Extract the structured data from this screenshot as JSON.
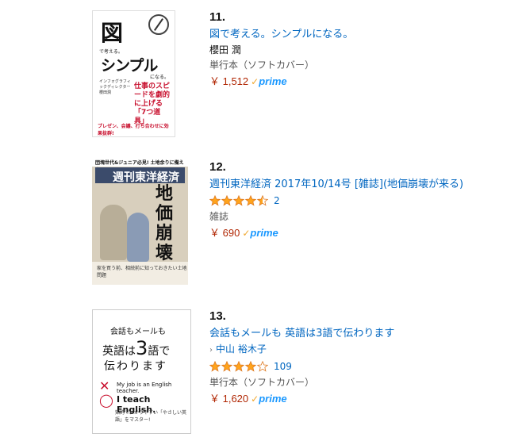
{
  "items": [
    {
      "rank": "11.",
      "title": "図で考える。シンプルになる。",
      "author": "櫻田 潤",
      "format": "単行本（ソフトカバー）",
      "price": "￥ 1,512",
      "prime_check": "✓",
      "prime_label": "prime",
      "cover": {
        "zu": "図",
        "sub1": "で考える。",
        "title": "シンプル",
        "sub2": "になる。",
        "red": "仕事のスピードを劇的に上げる「7つ道具」",
        "small": "インフォグラフィックディレクター 櫻田潤",
        "bottom": "プレゼン、会議、打ち合わせに効果抜群!"
      }
    },
    {
      "rank": "12.",
      "title": "週刊東洋経済 2017年10/14号 [雑誌](地価崩壊が来る)",
      "rating": 4.5,
      "rating_count": "2",
      "format": "雑誌",
      "price": "￥ 690",
      "prime_check": "✓",
      "prime_label": "prime",
      "cover": {
        "top": "団塊世代&ジュニア必見! 土地余りに備えよ",
        "brand": "週刊東洋経済",
        "big": "地価崩壊が来る",
        "bottom": "家を買う前、相続前に知っておきたい土地問題"
      }
    },
    {
      "rank": "13.",
      "title": "会話もメールも 英語は3語で伝わります",
      "author_arrow": "›",
      "author": "中山 裕木子",
      "rating": 4,
      "rating_count": "109",
      "format": "単行本（ソフトカバー）",
      "price": "￥ 1,620",
      "prime_check": "✓",
      "prime_label": "prime",
      "cover": {
        "l1": "会話もメールも",
        "l2a": "英語は",
        "l2b": "3",
        "l2c": "語で",
        "l3": "伝わります",
        "x": "✕",
        "o": "◯",
        "e1": "My job is an English teacher.",
        "e2": "I teach English.",
        "e3": "知的でわかりやすい「やさしい英語」をマスター!"
      }
    }
  ],
  "colors": {
    "link": "#0066c0",
    "price": "#b12704",
    "star": "#ffa41c",
    "prime": "#1a98ff"
  }
}
